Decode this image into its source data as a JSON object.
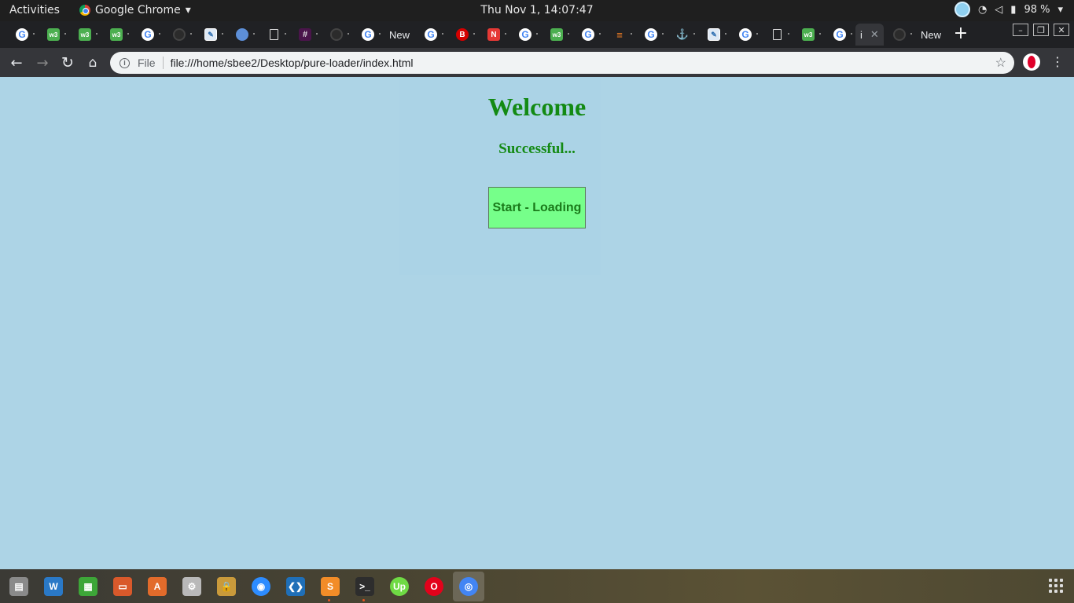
{
  "topbar": {
    "activities": "Activities",
    "app_name": "Google Chrome",
    "app_menu_caret": "▾",
    "clock": "Thu Nov  1, 14:07:47",
    "battery": "98 %",
    "tray_caret": "▾"
  },
  "tabs": [
    {
      "icon": "google-icon",
      "glyph": "G"
    },
    {
      "icon": "w3schools-icon",
      "glyph": "w3"
    },
    {
      "icon": "w3schools-icon",
      "glyph": "w3"
    },
    {
      "icon": "w3schools-icon",
      "glyph": "w3"
    },
    {
      "icon": "google-icon",
      "glyph": "G"
    },
    {
      "icon": "github-icon",
      "glyph": ""
    },
    {
      "icon": "image-icon",
      "glyph": "✎"
    },
    {
      "icon": "globe-icon",
      "glyph": ""
    },
    {
      "icon": "document-icon",
      "glyph": ""
    },
    {
      "icon": "slack-icon",
      "glyph": "#"
    },
    {
      "icon": "github-icon",
      "glyph": ""
    },
    {
      "icon": "google-icon",
      "glyph": "G"
    },
    {
      "icon": "new-tab-label",
      "label": "New"
    },
    {
      "icon": "google-icon",
      "glyph": "G"
    },
    {
      "icon": "bitdefender-icon",
      "glyph": "B"
    },
    {
      "icon": "netflix-icon",
      "glyph": "N"
    },
    {
      "icon": "google-icon",
      "glyph": "G"
    },
    {
      "icon": "w3schools-icon",
      "glyph": "w3"
    },
    {
      "icon": "google-icon",
      "glyph": "G"
    },
    {
      "icon": "stackoverflow-icon",
      "glyph": "≡"
    },
    {
      "icon": "google-icon",
      "glyph": "G"
    },
    {
      "icon": "anchor-icon",
      "glyph": "⚓"
    },
    {
      "icon": "image-icon",
      "glyph": "✎"
    },
    {
      "icon": "google-icon",
      "glyph": "G"
    },
    {
      "icon": "document-icon",
      "glyph": ""
    },
    {
      "icon": "w3schools-icon",
      "glyph": "w3"
    },
    {
      "icon": "google-icon",
      "glyph": "G"
    }
  ],
  "active_tab": {
    "label": "i",
    "close": "✕"
  },
  "trailing_tabs": [
    {
      "icon": "github-icon",
      "glyph": ""
    },
    {
      "icon": "new-tab-label",
      "label": "New"
    }
  ],
  "new_tab_button": "+",
  "window_controls": {
    "minimize": "–",
    "restore": "❐",
    "close": "✕"
  },
  "toolbar": {
    "back": "←",
    "forward": "→",
    "reload": "↻",
    "home": "⌂",
    "info": "i",
    "scheme": "File",
    "url": "file:///home/sbee2/Desktop/pure-loader/index.html",
    "star": "☆",
    "menu": "⋮"
  },
  "page": {
    "heading": "Welcome",
    "status": "Successful...",
    "start_button": "Start - Loading"
  },
  "dock": [
    {
      "name": "files-icon",
      "color": "#8a8a8a",
      "glyph": "▤"
    },
    {
      "name": "writer-icon",
      "color": "#2a79c7",
      "glyph": "W"
    },
    {
      "name": "calc-icon",
      "color": "#3da638",
      "glyph": "▦"
    },
    {
      "name": "impress-icon",
      "color": "#d9592b",
      "glyph": "▭"
    },
    {
      "name": "software-center-icon",
      "color": "#e26b2b",
      "glyph": "A"
    },
    {
      "name": "settings-icon",
      "color": "#b9b9b9",
      "glyph": "⚙"
    },
    {
      "name": "lock-icon",
      "color": "#c99a3b",
      "glyph": "🔒"
    },
    {
      "name": "zoom-icon",
      "color": "#2d8cff",
      "glyph": "◉"
    },
    {
      "name": "vscode-icon",
      "color": "#1f6fb8",
      "glyph": "❮❯"
    },
    {
      "name": "sublime-icon",
      "color": "#f28c28",
      "glyph": "S"
    },
    {
      "name": "terminal-icon",
      "color": "#2d2d2d",
      "glyph": ">_"
    },
    {
      "name": "upwork-icon",
      "color": "#6fda44",
      "glyph": "Up"
    },
    {
      "name": "opera-icon",
      "color": "#e3021b",
      "glyph": "O"
    },
    {
      "name": "chrome-icon",
      "color": "#4285f4",
      "glyph": "◎"
    }
  ]
}
